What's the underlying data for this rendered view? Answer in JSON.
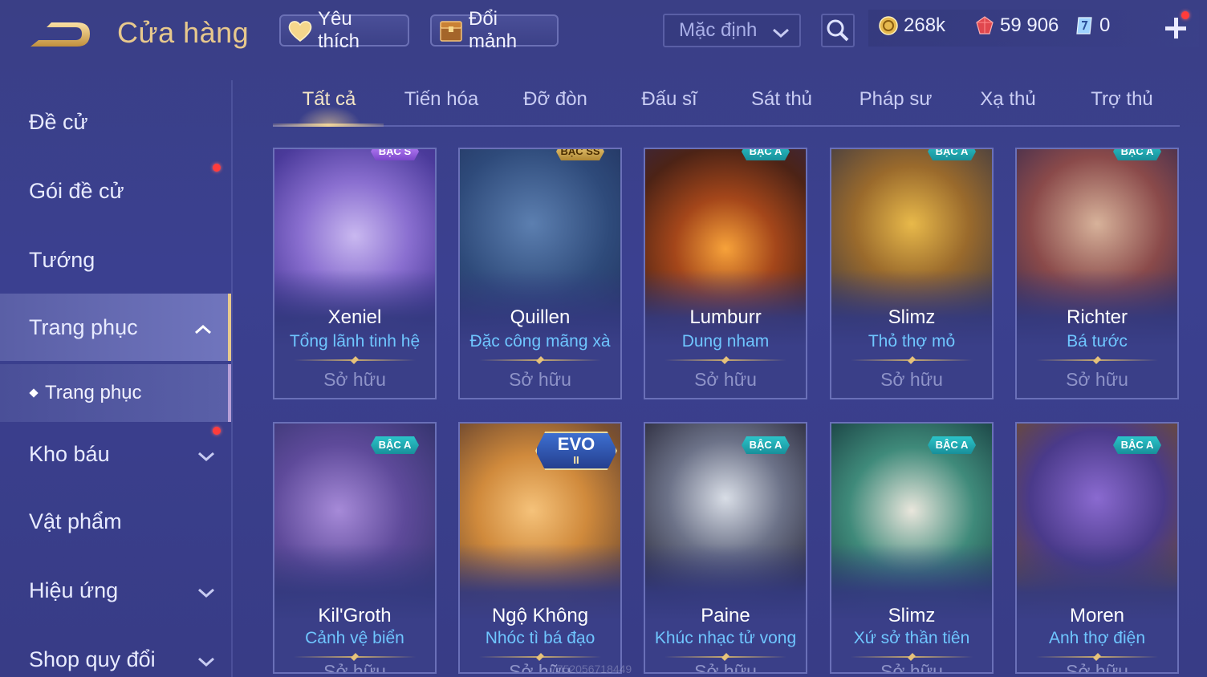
{
  "header": {
    "title": "Cửa hàng",
    "favorite_label": "Yêu thích",
    "exchange_label": "Đổi mảnh",
    "sort_value": "Mặc định",
    "currencies": {
      "gold": "268k",
      "gem": "59 906",
      "voucher": "0"
    }
  },
  "sidebar": {
    "items": [
      {
        "label": "Đề cử"
      },
      {
        "label": "Gói đề cử"
      },
      {
        "label": "Tướng"
      },
      {
        "label": "Trang phục"
      },
      {
        "label": "Kho báu"
      },
      {
        "label": "Vật phẩm"
      },
      {
        "label": "Hiệu ứng"
      },
      {
        "label": "Shop quy đổi"
      }
    ],
    "subitem": "Trang phục"
  },
  "tabs": [
    "Tất cả",
    "Tiến hóa",
    "Đỡ đòn",
    "Đấu sĩ",
    "Sát thủ",
    "Pháp sư",
    "Xạ thủ",
    "Trợ thủ"
  ],
  "cards": [
    {
      "name": "Xeniel",
      "skin": "Tổng lãnh tinh hệ",
      "status": "Sở hữu",
      "badge": "BẬC S"
    },
    {
      "name": "Quillen",
      "skin": "Đặc công mãng xà",
      "status": "Sở hữu",
      "badge": "BẬC SS"
    },
    {
      "name": "Lumburr",
      "skin": "Dung nham",
      "status": "Sở hữu",
      "badge": "BẬC A"
    },
    {
      "name": "Slimz",
      "skin": "Thỏ thợ mỏ",
      "status": "Sở hữu",
      "badge": "BẬC A"
    },
    {
      "name": "Richter",
      "skin": "Bá tước",
      "status": "Sở hữu",
      "badge": "BẬC A"
    },
    {
      "name": "Kil'Groth",
      "skin": "Cảnh vệ biển",
      "status": "Sở hữu",
      "badge": "BẬC A"
    },
    {
      "name": "Ngộ Không",
      "skin": "Nhóc tì bá đạo",
      "status": "Sở hữu",
      "badge": "EVO",
      "badge_sub": "II"
    },
    {
      "name": "Paine",
      "skin": "Khúc nhạc tử vong",
      "status": "Sở hữu",
      "badge": "BẬC A"
    },
    {
      "name": "Slimz",
      "skin": "Xứ sở thần tiên",
      "status": "Sở hữu",
      "badge": "BẬC A"
    },
    {
      "name": "Moren",
      "skin": "Anh thợ điện",
      "status": "Sở hữu",
      "badge": "BẬC A"
    }
  ],
  "watermark": "7752056718449",
  "colors": {
    "background": "#3a3f86",
    "title_gold": "#e8c98d",
    "skin_name_blue": "#6fc6ff",
    "notification_red": "#ff3c3c"
  }
}
